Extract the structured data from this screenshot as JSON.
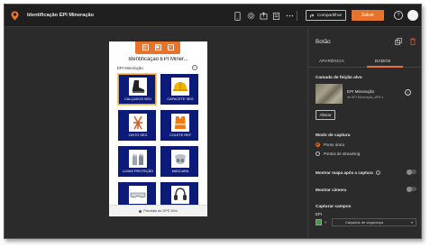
{
  "app": {
    "title": "Identificação EPI Mineração",
    "share_label": "Compartilhar",
    "save_label": "Salvar",
    "help_glyph": "?"
  },
  "toolbar_icons": [
    "phone-icon",
    "settings-icon",
    "export-icon",
    "clipboard-icon",
    "more-icon"
  ],
  "preview": {
    "form_title": "Identificação EPI Miner...",
    "group_label": "EPI Mineração",
    "tiles": [
      {
        "label": "CALÇADOS SEG",
        "icon": "boot-icon",
        "selected": true
      },
      {
        "label": "CAPACETE SEG",
        "icon": "helmet-icon",
        "selected": false
      },
      {
        "label": "CINTO SEG",
        "icon": "harness-icon",
        "selected": false
      },
      {
        "label": "COLETE REF",
        "icon": "vest-icon",
        "selected": false
      },
      {
        "label": "LUVAS PROTEÇÃO",
        "icon": "gloves-icon",
        "selected": false
      },
      {
        "label": "MÁSCARA",
        "icon": "mask-icon",
        "selected": false
      },
      {
        "label": "",
        "icon": "goggles-icon",
        "selected": false
      },
      {
        "label": "",
        "icon": "ear-protector-icon",
        "selected": false
      }
    ],
    "footer": "Precisão do GPS 30m"
  },
  "panel": {
    "title": "Botão",
    "tabs": [
      "APARÊNCIA",
      "DADOS"
    ],
    "active_tab": "DADOS",
    "source_layer_label": "Camada de feição alvo",
    "layer_name": "EPI Mineração",
    "layer_sub": "de EPI Mineração_WFL1",
    "change_label": "Alterar",
    "capture_mode_label": "Modo de captura",
    "capture_options": [
      "Ponto único",
      "Pontos de streaming"
    ],
    "show_map_label": "Mostrar mapa após a captura",
    "show_camera_label": "Mostrar câmera",
    "capture_fields_label": "Capturar campos",
    "field_name": "EPI",
    "field_value": "Calçados de segurança",
    "colors": {
      "accent": "#e8742b",
      "tile": "#0c1b7a",
      "panel": "#2b2b2b",
      "swatch": "#3d9e3d"
    }
  }
}
